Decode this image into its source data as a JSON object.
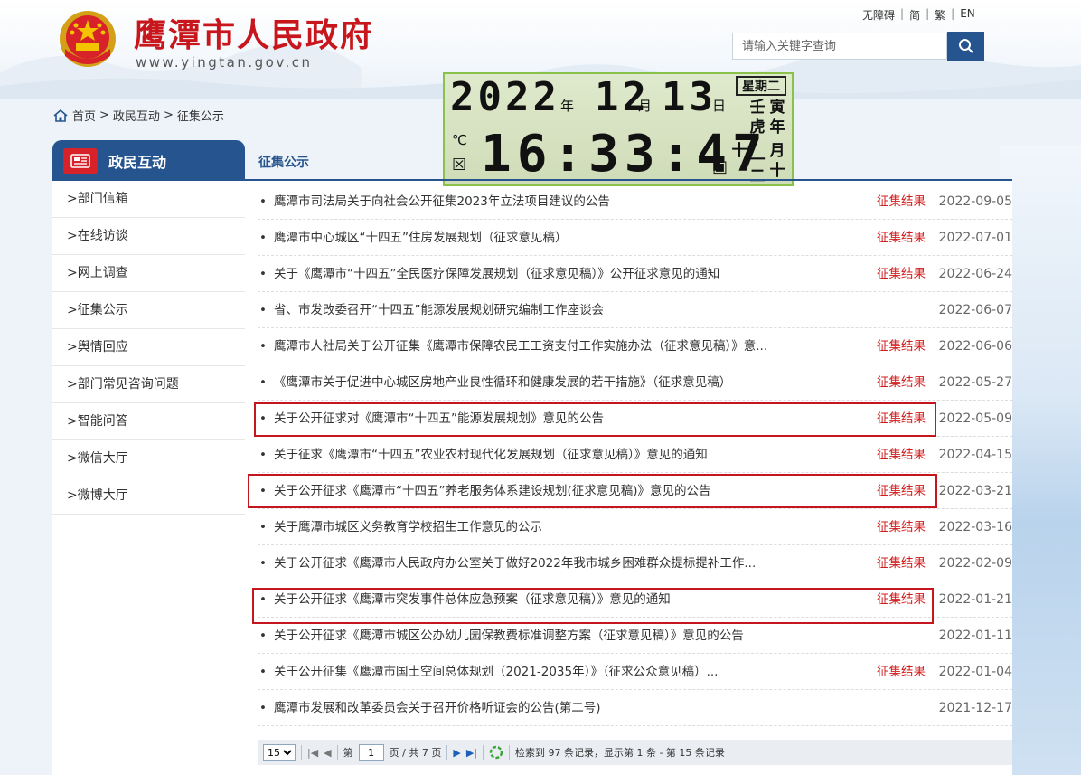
{
  "header": {
    "site_title": "鹰潭市人民政府",
    "site_url": "www.yingtan.gov.cn",
    "top_links": [
      "无障碍",
      "简",
      "繁",
      "EN"
    ],
    "search_placeholder": "请输入关键字查询"
  },
  "clock": {
    "year": "2022",
    "month": "12",
    "day": "13",
    "unit_year": "年",
    "unit_month": "月",
    "unit_day": "日",
    "weekday": "星期二",
    "time": "16:33:47",
    "lunar_col1": [
      "壬",
      "虎"
    ],
    "lunar_col2": [
      "寅",
      "年",
      "月",
      "十"
    ],
    "lunar_mid": [
      "十",
      "一",
      "二"
    ],
    "temp_icon": "℃",
    "mail_icon": "☒",
    "cal_icon": "▣"
  },
  "breadcrumb": [
    "首页",
    "政民互动",
    "征集公示"
  ],
  "sidebar": {
    "title": "政民互动",
    "items": [
      "部门信箱",
      "在线访谈",
      "网上调查",
      "征集公示",
      "舆情回应",
      "部门常见咨询问题",
      "智能问答",
      "微信大厅",
      "微博大厅"
    ]
  },
  "main": {
    "title": "征集公示",
    "rows": [
      {
        "title": "鹰潭市司法局关于向社会公开征集2023年立法项目建议的公告",
        "result": "征集结果",
        "date": "2022-09-05"
      },
      {
        "title": "鹰潭市中心城区“十四五”住房发展规划（征求意见稿）",
        "result": "征集结果",
        "date": "2022-07-01"
      },
      {
        "title": "关于《鹰潭市“十四五”全民医疗保障发展规划（征求意见稿）》公开征求意见的通知",
        "result": "征集结果",
        "date": "2022-06-24"
      },
      {
        "title": "省、市发改委召开“十四五”能源发展规划研究编制工作座谈会",
        "result": "",
        "date": "2022-06-07"
      },
      {
        "title": "鹰潭市人社局关于公开征集《鹰潭市保障农民工工资支付工作实施办法（征求意见稿）》意...",
        "result": "征集结果",
        "date": "2022-06-06"
      },
      {
        "title": "《鹰潭市关于促进中心城区房地产业良性循环和健康发展的若干措施》（征求意见稿）",
        "result": "征集结果",
        "date": "2022-05-27"
      },
      {
        "title": "关于公开征求对《鹰潭市“十四五”能源发展规划》意见的公告",
        "result": "征集结果",
        "date": "2022-05-09"
      },
      {
        "title": "关于征求《鹰潭市“十四五”农业农村现代化发展规划（征求意见稿）》意见的通知",
        "result": "征集结果",
        "date": "2022-04-15"
      },
      {
        "title": "关于公开征求《鹰潭市“十四五”养老服务体系建设规划(征求意见稿)》意见的公告",
        "result": "征集结果",
        "date": "2022-03-21"
      },
      {
        "title": "关于鹰潭市城区义务教育学校招生工作意见的公示",
        "result": "征集结果",
        "date": "2022-03-16"
      },
      {
        "title": "关于公开征求《鹰潭市人民政府办公室关于做好2022年我市城乡困难群众提标提补工作...",
        "result": "征集结果",
        "date": "2022-02-09"
      },
      {
        "title": "关于公开征求《鹰潭市突发事件总体应急预案（征求意见稿）》意见的通知",
        "result": "征集结果",
        "date": "2022-01-21"
      },
      {
        "title": "关于公开征求《鹰潭市城区公办幼儿园保教费标准调整方案（征求意见稿）》意见的公告",
        "result": "",
        "date": "2022-01-11"
      },
      {
        "title": "关于公开征集《鹰潭市国土空间总体规划（2021-2035年）》（征求公众意见稿）...",
        "result": "征集结果",
        "date": "2022-01-04"
      },
      {
        "title": "鹰潭市发展和改革委员会关于召开价格听证会的公告(第二号)",
        "result": "",
        "date": "2021-12-17"
      }
    ]
  },
  "pager": {
    "page_size": "15",
    "label_page": "第",
    "current_page": "1",
    "label_total": "页 / 共 7 页",
    "summary": "检索到 97 条记录，显示第 1 条 - 第 15 条记录"
  }
}
